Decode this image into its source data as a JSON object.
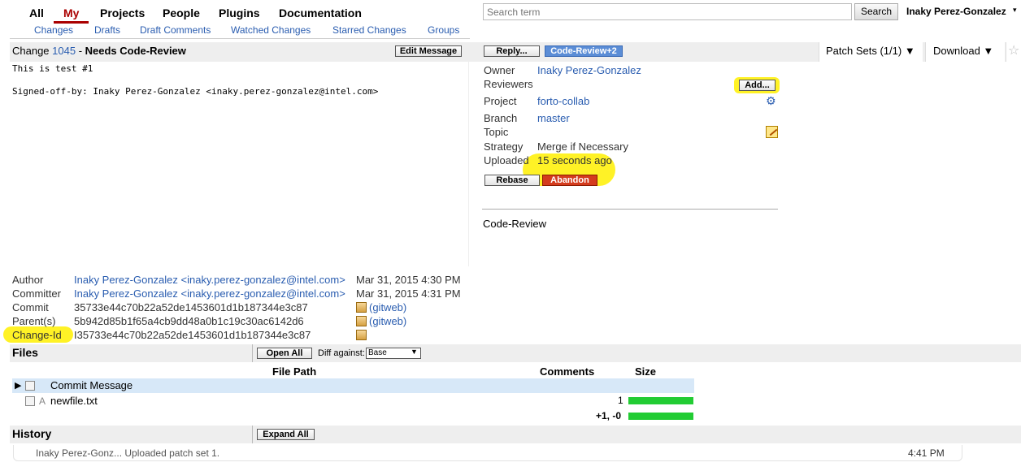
{
  "menu": {
    "tabs": [
      "All",
      "My",
      "Projects",
      "People",
      "Plugins",
      "Documentation"
    ],
    "active": "My",
    "submenu": [
      "Changes",
      "Drafts",
      "Draft Comments",
      "Watched Changes",
      "Starred Changes",
      "Groups"
    ]
  },
  "search": {
    "placeholder": "Search term",
    "button": "Search"
  },
  "user": {
    "name": "Inaky Perez-Gonzalez",
    "caret": "▾"
  },
  "change": {
    "prefix": "Change ",
    "number": "1045",
    "sep": " - ",
    "status": "Needs Code-Review",
    "edit_message": "Edit Message",
    "reply": "Reply...",
    "label_badge": "Code-Review+2",
    "patch_sets": "Patch Sets (1/1) ▼",
    "download": "Download ▼",
    "star": "☆"
  },
  "commit_message": {
    "line1": "This is test #1",
    "line2": "Signed-off-by: Inaky Perez-Gonzalez <inaky.perez-gonzalez@intel.com>"
  },
  "info": {
    "owner_label": "Owner",
    "owner": "Inaky Perez-Gonzalez",
    "reviewers_label": "Reviewers",
    "add_button": "Add...",
    "project_label": "Project",
    "project": "forto-collab",
    "branch_label": "Branch",
    "branch": "master",
    "topic_label": "Topic",
    "strategy_label": "Strategy",
    "strategy": "Merge if Necessary",
    "uploaded_label": "Uploaded",
    "uploaded": "15 seconds ago",
    "rebase": "Rebase",
    "abandon": "Abandon",
    "code_review_label": "Code-Review"
  },
  "meta": {
    "author_label": "Author",
    "author": "Inaky Perez-Gonzalez <inaky.perez-gonzalez@intel.com>",
    "author_date": "Mar 31, 2015 4:30 PM",
    "committer_label": "Committer",
    "committer": "Inaky Perez-Gonzalez <inaky.perez-gonzalez@intel.com>",
    "committer_date": "Mar 31, 2015 4:31 PM",
    "commit_label": "Commit",
    "commit": "35733e44c70b22a52de1453601d1b187344e3c87",
    "commit_gitweb": "(gitweb)",
    "parents_label": "Parent(s)",
    "parents": "5b942d85b1f65a4cb9dd48a0b1c19c30ac6142d6",
    "parents_gitweb": "(gitweb)",
    "changeid_label": "Change-Id",
    "changeid": "I35733e44c70b22a52de1453601d1b187344e3c87"
  },
  "files": {
    "title": "Files",
    "open_all": "Open All",
    "diff_against_label": "Diff against:",
    "diff_against_value": "Base",
    "columns": {
      "path": "File Path",
      "comments": "Comments",
      "size": "Size"
    },
    "rows": [
      {
        "name": "Commit Message",
        "status": "",
        "size": ""
      },
      {
        "name": "newfile.txt",
        "status": "A",
        "size": "1"
      }
    ],
    "total": "+1, -0"
  },
  "history": {
    "title": "History",
    "expand_all": "Expand All",
    "author": "Inaky Perez-Gonz...",
    "message": "Uploaded patch set 1.",
    "time": "4:41 PM"
  }
}
